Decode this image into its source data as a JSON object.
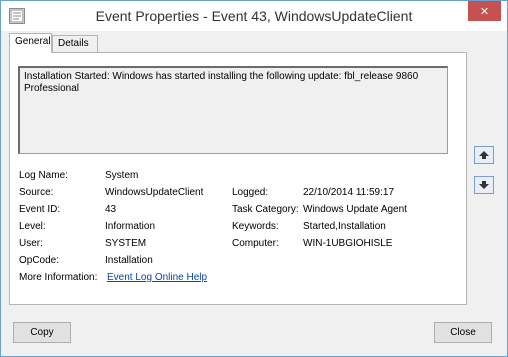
{
  "window": {
    "title": "Event Properties - Event 43, WindowsUpdateClient",
    "close_glyph": "✕"
  },
  "tabs": [
    {
      "label": "General",
      "active": true
    },
    {
      "label": "Details",
      "active": false
    }
  ],
  "event": {
    "description": "Installation Started: Windows has started installing the following update: fbl_release 9860 Professional",
    "log_name_label": "Log Name:",
    "log_name": "System",
    "source_label": "Source:",
    "source": "WindowsUpdateClient",
    "logged_label": "Logged:",
    "logged": "22/10/2014 11:59:17",
    "event_id_label": "Event ID:",
    "event_id": "43",
    "task_category_label": "Task Category:",
    "task_category": "Windows Update Agent",
    "level_label": "Level:",
    "level": "Information",
    "keywords_label": "Keywords:",
    "keywords": "Started,Installation",
    "user_label": "User:",
    "user": "SYSTEM",
    "computer_label": "Computer:",
    "computer": "WIN-1UBGIOHISLE",
    "opcode_label": "OpCode:",
    "opcode": "Installation",
    "more_info_label": "More Information:",
    "more_info_link": "Event Log Online Help"
  },
  "nav": {
    "up_icon": "arrow-up-icon",
    "down_icon": "arrow-down-icon"
  },
  "footer": {
    "copy_label": "Copy",
    "close_label": "Close"
  }
}
